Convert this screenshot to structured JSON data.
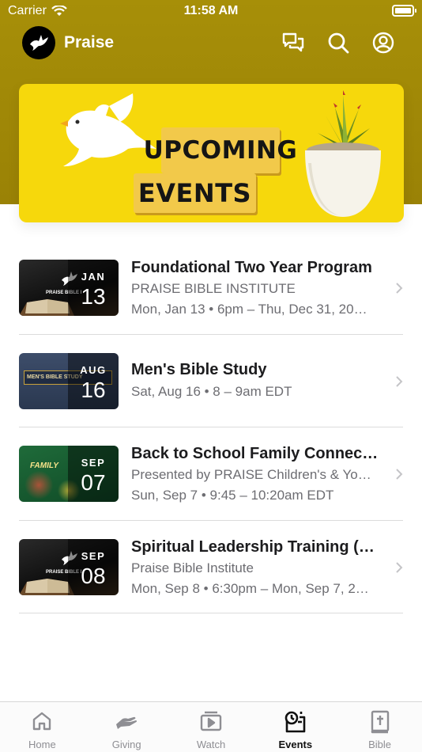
{
  "status_bar": {
    "carrier": "Carrier",
    "time": "11:58 AM"
  },
  "app": {
    "title": "Praise"
  },
  "appbar_icons": [
    "chat-icon",
    "search-icon",
    "profile-icon"
  ],
  "banner": {
    "line1": "UPCOMING",
    "line2": "EVENTS"
  },
  "events": [
    {
      "title": "Foundational Two Year Program",
      "subtitle": "PRAISE BIBLE INSTITUTE",
      "when": "Mon, Jan 13 • 6pm – Thu, Dec 31, 20…",
      "month": "JAN",
      "day": "13",
      "thumb_text": "PRAISE BIBLE I"
    },
    {
      "title": "Men's Bible Study",
      "when": "Sat, Aug 16 • 8 – 9am EDT",
      "month": "AUG",
      "day": "16",
      "thumb_text": "MEN'S BIBLE STUDY"
    },
    {
      "title": "Back to School Family Connec…",
      "subtitle": "Presented by PRAISE Children's & Yo…",
      "when": "Sun, Sep 7 • 9:45 – 10:20am EDT",
      "month": "SEP",
      "day": "07",
      "thumb_text": "FAMILY"
    },
    {
      "title": "Spiritual Leadership Training (…",
      "subtitle": "Praise Bible Institute",
      "when": "Mon, Sep 8 • 6:30pm – Mon, Sep 7, 2…",
      "month": "SEP",
      "day": "08",
      "thumb_text": "PRAISE BIBLE I"
    }
  ],
  "tabs": [
    {
      "label": "Home",
      "icon": "home-icon"
    },
    {
      "label": "Giving",
      "icon": "giving-icon"
    },
    {
      "label": "Watch",
      "icon": "watch-icon"
    },
    {
      "label": "Events",
      "icon": "events-icon",
      "active": true
    },
    {
      "label": "Bible",
      "icon": "bible-icon"
    }
  ],
  "colors": {
    "header": "#a08907",
    "banner": "#f6d80c",
    "active_tab": "#111111",
    "inactive_tab": "#8e8e93"
  }
}
